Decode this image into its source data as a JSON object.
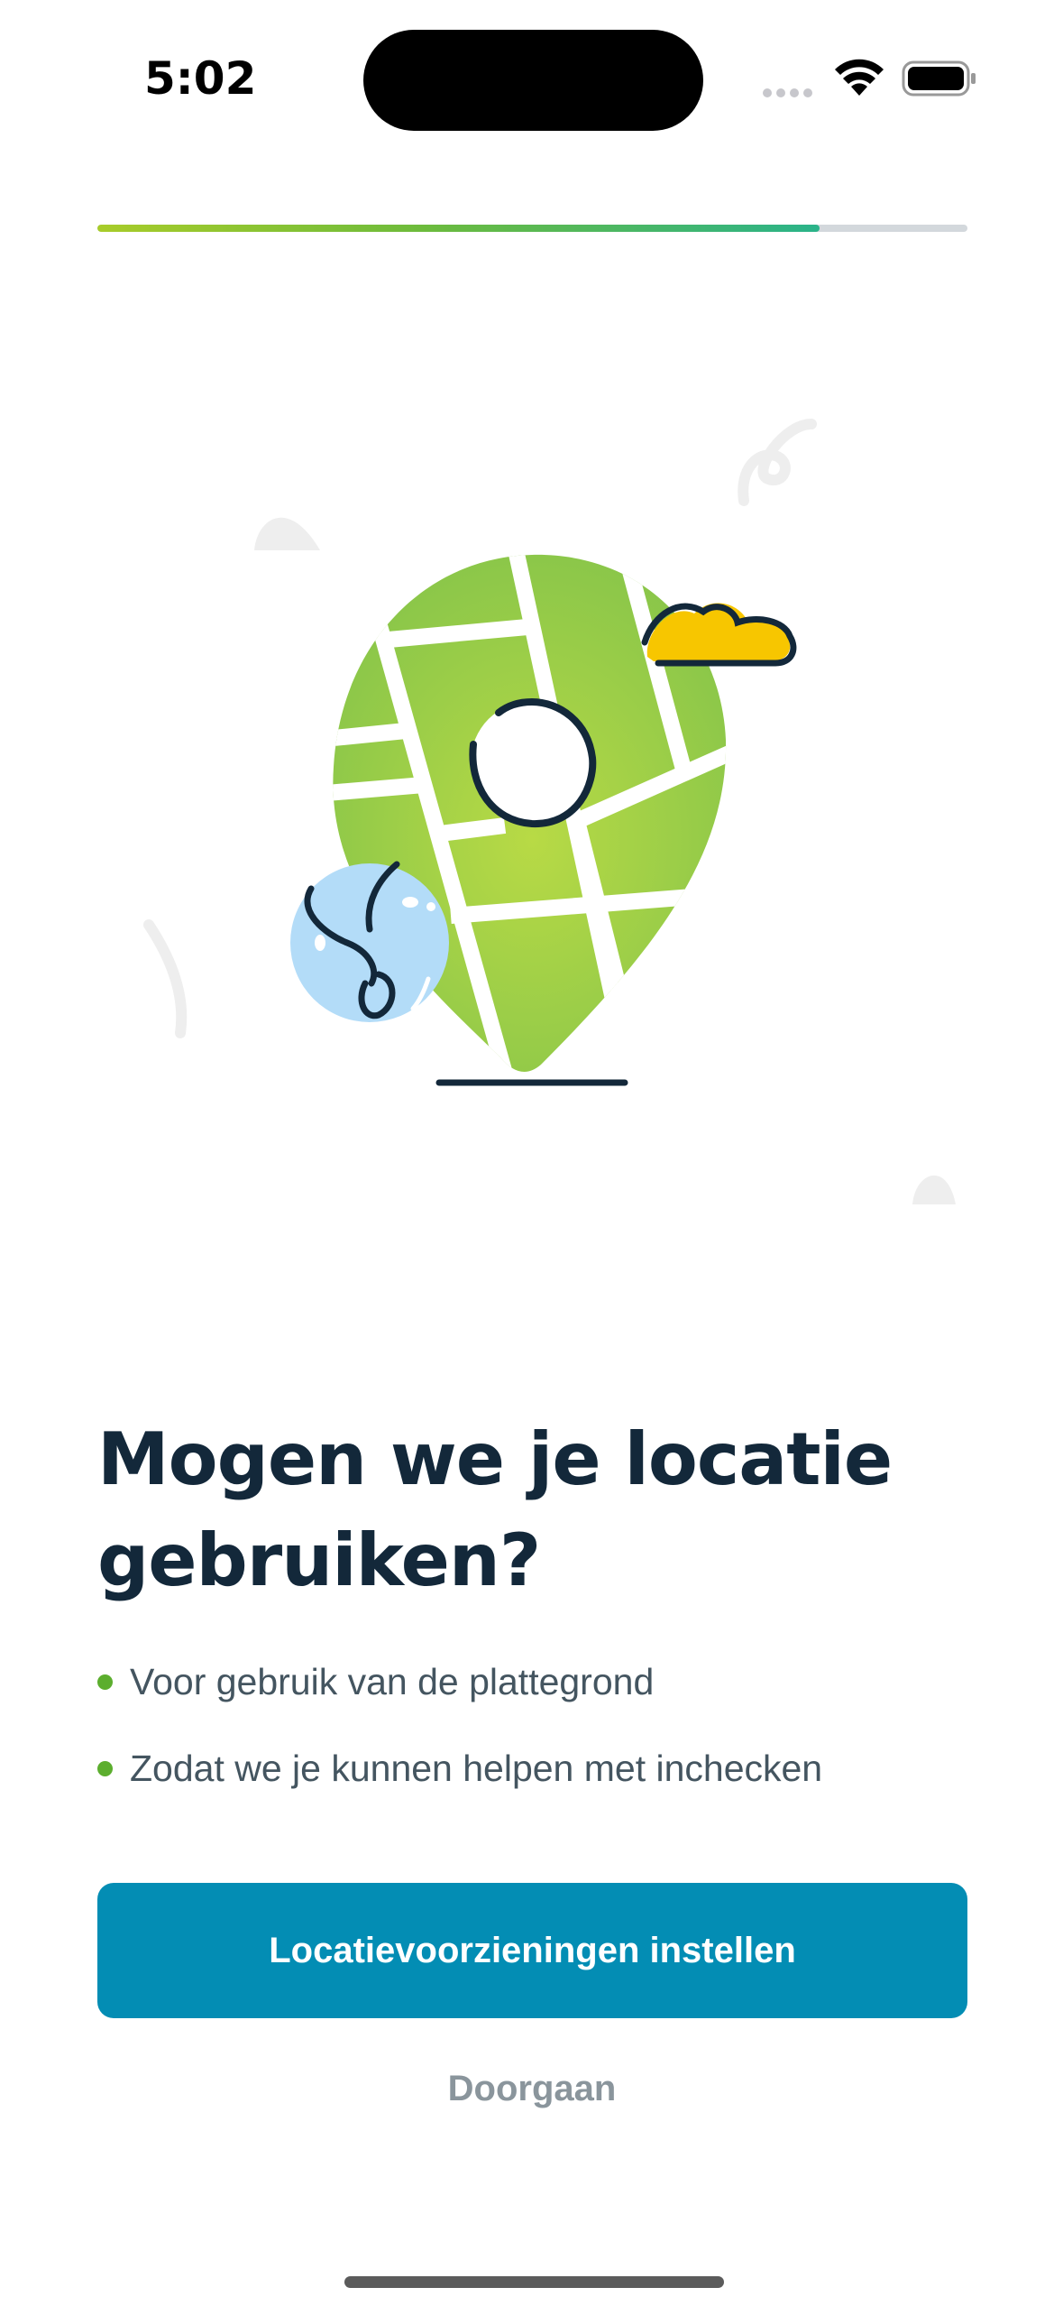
{
  "status_bar": {
    "time": "5:02"
  },
  "progress": {
    "value_percent": 83
  },
  "illustration": {
    "icon": "map-location-pin-icon",
    "colors": {
      "pin_green": "#8dc63f",
      "pin_light": "#b5d84a",
      "cloud": "#f7c600",
      "globe": "#b3dcf8",
      "outline": "#13283a"
    }
  },
  "content": {
    "title_line1": "Mogen we je locatie",
    "title_line2": "gebruiken?",
    "bullets": [
      "Voor gebruik van de plattegrond",
      "Zodat we je kunnen helpen met inchecken"
    ]
  },
  "actions": {
    "primary_label": "Locatievoorzieningen instellen",
    "secondary_label": "Doorgaan"
  },
  "colors": {
    "accent": "#038db4",
    "bullet": "#5cae2e",
    "title": "#13283a"
  }
}
